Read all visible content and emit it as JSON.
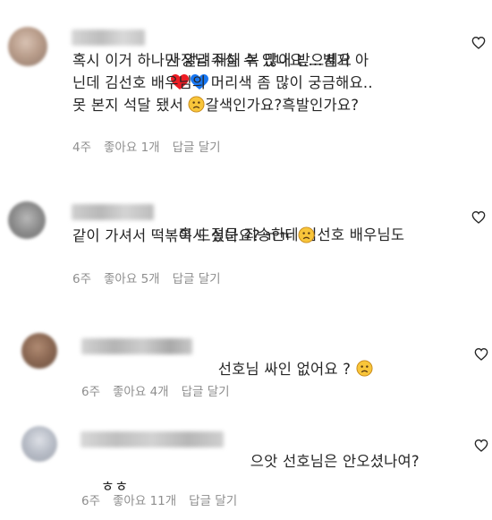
{
  "comments": [
    {
      "text_first": "사장님 새해 복 많이 받으세요",
      "text_rest": "혹시 이거 하나만 알려주실 수 있나요....별거 아\n닌데 김선호 배우님의 머리색 좀 많이 궁금해요..\n못 본지 석달 됐서 ",
      "text_tail": "갈색인가요?흑발인가요?",
      "emoji_hearts": [
        "red-heart",
        "blue-heart"
      ],
      "emoji_face": "sad-face",
      "time": "4주",
      "likes": "좋아요 1개",
      "reply": "답글 달기"
    },
    {
      "text_first": "혹시 질문 죄송한데 김선호 배우님도",
      "text_rest": "같이 가셔서 떡볶이 드셨나요? ㅠㅠ",
      "emoji_face": "sad-face",
      "time": "6주",
      "likes": "좋아요 5개",
      "reply": "답글 달기"
    },
    {
      "text_first": "선호님 싸인 없어요 ?",
      "emoji_face": "sad-face",
      "time": "6주",
      "likes": "좋아요 4개",
      "reply": "답글 달기"
    },
    {
      "text_first": "으앗 선호님은 안오셨나여?",
      "text_rest": "ㅎㅎ",
      "time": "6주",
      "likes": "좋아요 11개",
      "reply": "답글 달기"
    }
  ],
  "colors": {
    "text": "#262626",
    "meta": "#8e8e8e",
    "heart_red": "#ed1c24",
    "heart_blue": "#1877f2",
    "emoji_yellow": "#f8c53a"
  },
  "icons": {
    "like": "heart-outline-icon"
  }
}
